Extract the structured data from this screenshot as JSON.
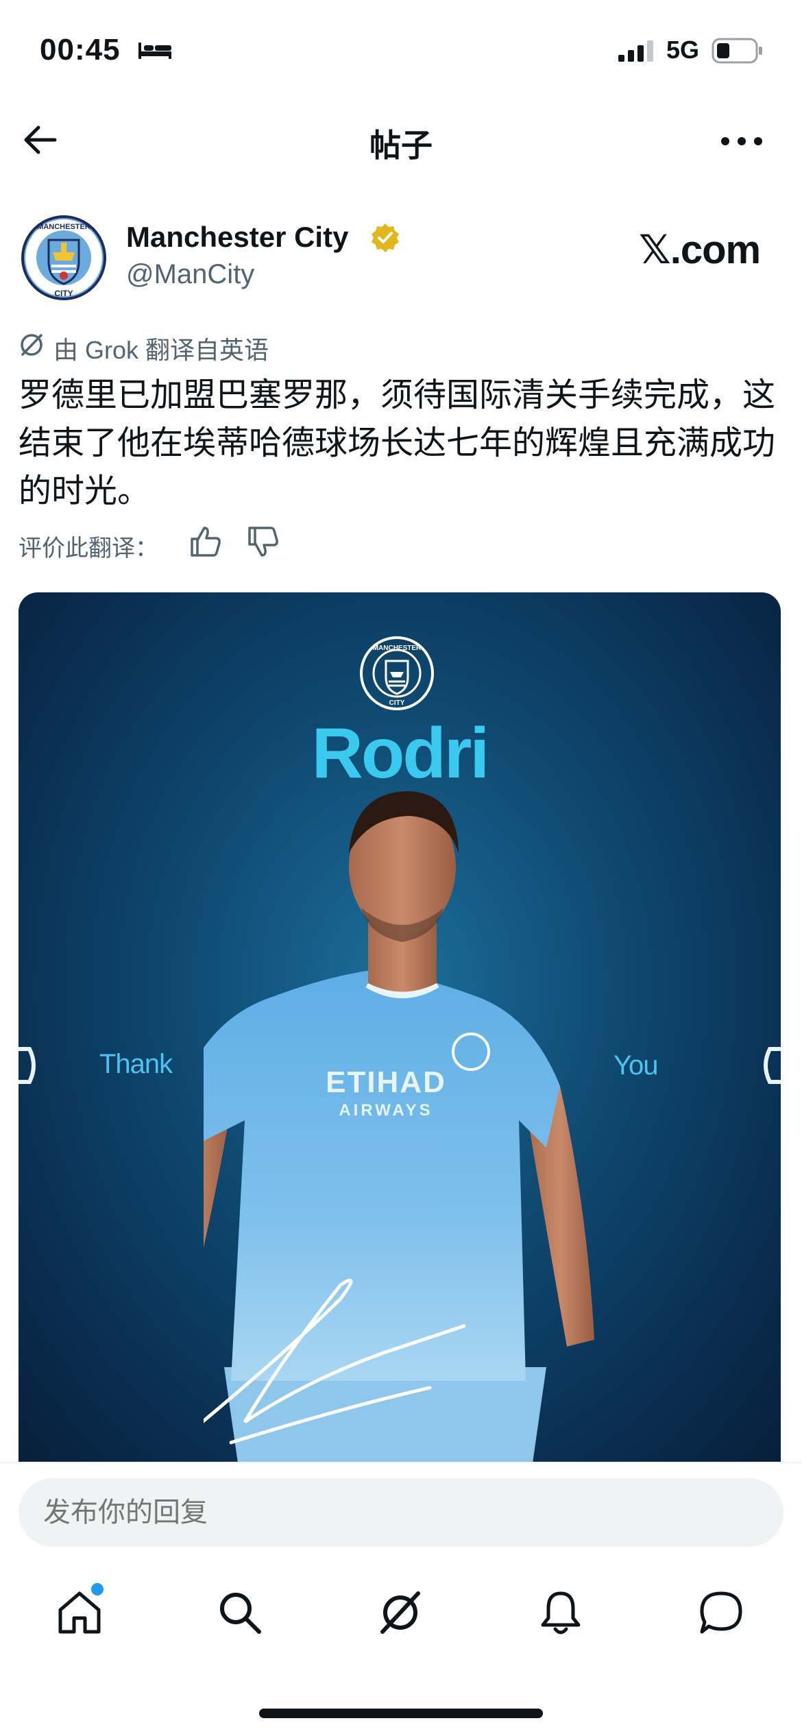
{
  "status_bar": {
    "time": "00:45",
    "network": "5G",
    "icons": [
      "bed-icon",
      "signal-icon",
      "battery-icon"
    ],
    "battery_level": 0.3
  },
  "header": {
    "title": "帖子",
    "icons": [
      "back-arrow-icon",
      "more-icon"
    ]
  },
  "author": {
    "name": "Manchester City",
    "handle": "@ManCity",
    "verified_color": "#e2b719",
    "source": "𝕏.com"
  },
  "translation": {
    "note": "由 Grok 翻译自英语",
    "text": "罗德里已加盟巴塞罗那，须待国际清关手续完成，这结束了他在埃蒂哈德球场长达七年的辉煌且充满成功的时光。",
    "rate_label": "评价此翻译：",
    "icons": [
      "grok-icon",
      "thumb-up-icon",
      "thumb-down-icon"
    ]
  },
  "media": {
    "title": "Rodri",
    "left_word": "Thank",
    "right_word": "You",
    "sponsor": "ETIHAD",
    "sponsor_sub": "AIRWAYS",
    "accent_color": "#3ac9ef"
  },
  "reply": {
    "placeholder": "发布你的回复"
  },
  "nav": {
    "items": [
      "home-icon",
      "search-icon",
      "grok-icon",
      "notifications-icon",
      "messages-icon"
    ],
    "notification_dot_color": "#1d9bf0"
  }
}
